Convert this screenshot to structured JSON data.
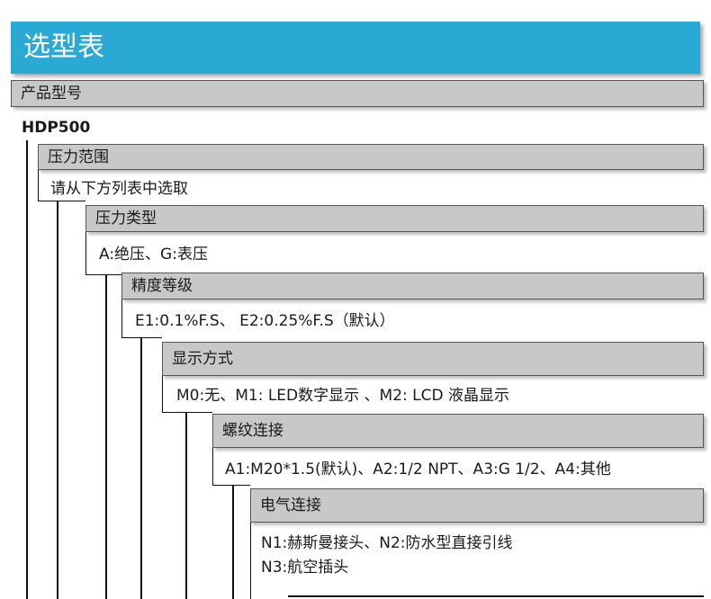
{
  "title": "选型表",
  "product_model": {
    "label": "产品型号",
    "code": "HDP500"
  },
  "sections": [
    {
      "label": "压力范围",
      "options": [
        "请从下方列表中选取"
      ]
    },
    {
      "label": "压力类型",
      "options": [
        "A:绝压、G:表压"
      ]
    },
    {
      "label": "精度等级",
      "options": [
        "E1:0.1%F.S、 E2:0.25%F.S（默认）"
      ]
    },
    {
      "label": "显示方式",
      "options": [
        "M0:无、M1: LED数字显示 、M2: LCD 液晶显示"
      ]
    },
    {
      "label": "螺纹连接",
      "options": [
        "A1:M20*1.5(默认)、A2:1/2 NPT、A3:G 1/2、A4:其他"
      ]
    },
    {
      "label": "电气连接",
      "options": [
        "N1:赫斯曼接头、N2:防水型直接引线",
        "N3:航空插头"
      ]
    }
  ],
  "colors": {
    "header": "#29a9d3",
    "section_bar": "#c8c8c8",
    "line": "#111111"
  }
}
